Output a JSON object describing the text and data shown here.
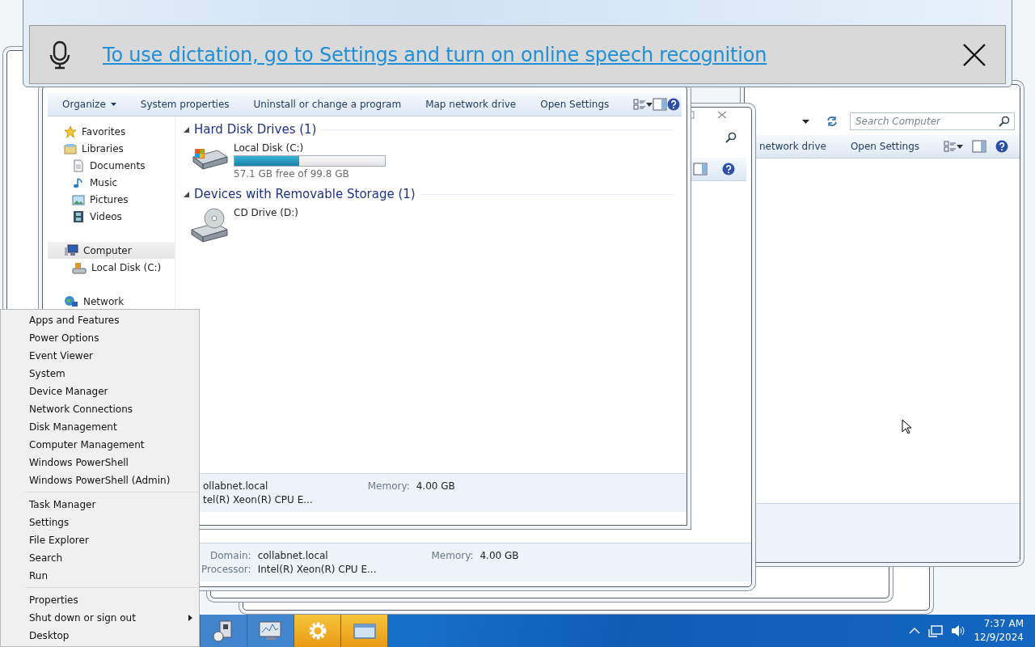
{
  "dictation_bar": {
    "message": "To use dictation, go to Settings and turn on online speech recognition"
  },
  "back_window": {
    "search": {
      "placeholder": "Search Computer"
    },
    "toolbar": [
      "network drive",
      "Open Settings"
    ]
  },
  "middle_window": {
    "details": [
      [
        {
          "label": "Domain:",
          "value": "collabnet.local"
        },
        {
          "label": "Memory:",
          "value": "4.00 GB"
        }
      ],
      [
        {
          "label": "Processor:",
          "value": "Intel(R) Xeon(R) CPU E..."
        }
      ]
    ]
  },
  "explorer": {
    "toolbar": [
      {
        "label": "Organize",
        "dropdown": true
      },
      {
        "label": "System properties",
        "dropdown": false
      },
      {
        "label": "Uninstall or change a program",
        "dropdown": false
      },
      {
        "label": "Map network drive",
        "dropdown": false
      },
      {
        "label": "Open Settings",
        "dropdown": false
      }
    ],
    "sidebar": [
      {
        "label": "Favorites",
        "kind": "favorites",
        "selected": false
      },
      {
        "label": "Libraries",
        "kind": "libraries",
        "selected": false,
        "children": [
          {
            "label": "Documents",
            "kind": "documents",
            "selected": false
          },
          {
            "label": "Music",
            "kind": "music",
            "selected": false
          },
          {
            "label": "Pictures",
            "kind": "pictures",
            "selected": false
          },
          {
            "label": "Videos",
            "kind": "videos",
            "selected": false
          }
        ]
      },
      {
        "label": "Computer",
        "kind": "computer",
        "selected": true,
        "children": [
          {
            "label": "Local Disk (C:)",
            "kind": "drive",
            "selected": false
          }
        ]
      },
      {
        "label": "Network",
        "kind": "network",
        "selected": false
      }
    ],
    "groups": [
      {
        "title": "Hard Disk Drives (1)",
        "items": [
          {
            "kind": "disk",
            "name": "Local Disk (C:)",
            "level": 0.43,
            "free": "57.1 GB free of 99.8 GB"
          }
        ]
      },
      {
        "title": "Devices with Removable Storage (1)",
        "items": [
          {
            "kind": "cd",
            "name": "CD Drive (D:)"
          }
        ]
      }
    ],
    "details": [
      [
        {
          "value": "ollabnet.local"
        },
        {
          "label": "Memory:",
          "value": "4.00 GB"
        }
      ],
      [
        {
          "value": "tel(R) Xeon(R) CPU E..."
        }
      ]
    ]
  },
  "context_menu": {
    "sections": [
      [
        {
          "label": "Apps and Features",
          "submenu": false
        },
        {
          "label": "Power Options",
          "submenu": false
        },
        {
          "label": "Event Viewer",
          "submenu": false
        },
        {
          "label": "System",
          "submenu": false
        },
        {
          "label": "Device Manager",
          "submenu": false
        },
        {
          "label": "Network Connections",
          "submenu": false
        },
        {
          "label": "Disk Management",
          "submenu": false
        },
        {
          "label": "Computer Management",
          "submenu": false
        },
        {
          "label": "Windows PowerShell",
          "submenu": false
        },
        {
          "label": "Windows PowerShell (Admin)",
          "submenu": false
        }
      ],
      [
        {
          "label": "Task Manager",
          "submenu": false
        },
        {
          "label": "Settings",
          "submenu": false
        },
        {
          "label": "File Explorer",
          "submenu": false
        },
        {
          "label": "Search",
          "submenu": false
        },
        {
          "label": "Run",
          "submenu": false
        }
      ],
      [
        {
          "label": "Properties",
          "submenu": false
        },
        {
          "label": "Shut down or sign out",
          "submenu": true
        },
        {
          "label": "Desktop",
          "submenu": false
        }
      ]
    ]
  },
  "taskbar": {
    "buttons": [
      {
        "kind": "devices",
        "active": false
      },
      {
        "kind": "monitor",
        "active": false
      },
      {
        "kind": "gear",
        "active": true
      },
      {
        "kind": "window",
        "active": true
      }
    ],
    "time": "7:37 AM",
    "date": "12/9/2024"
  }
}
